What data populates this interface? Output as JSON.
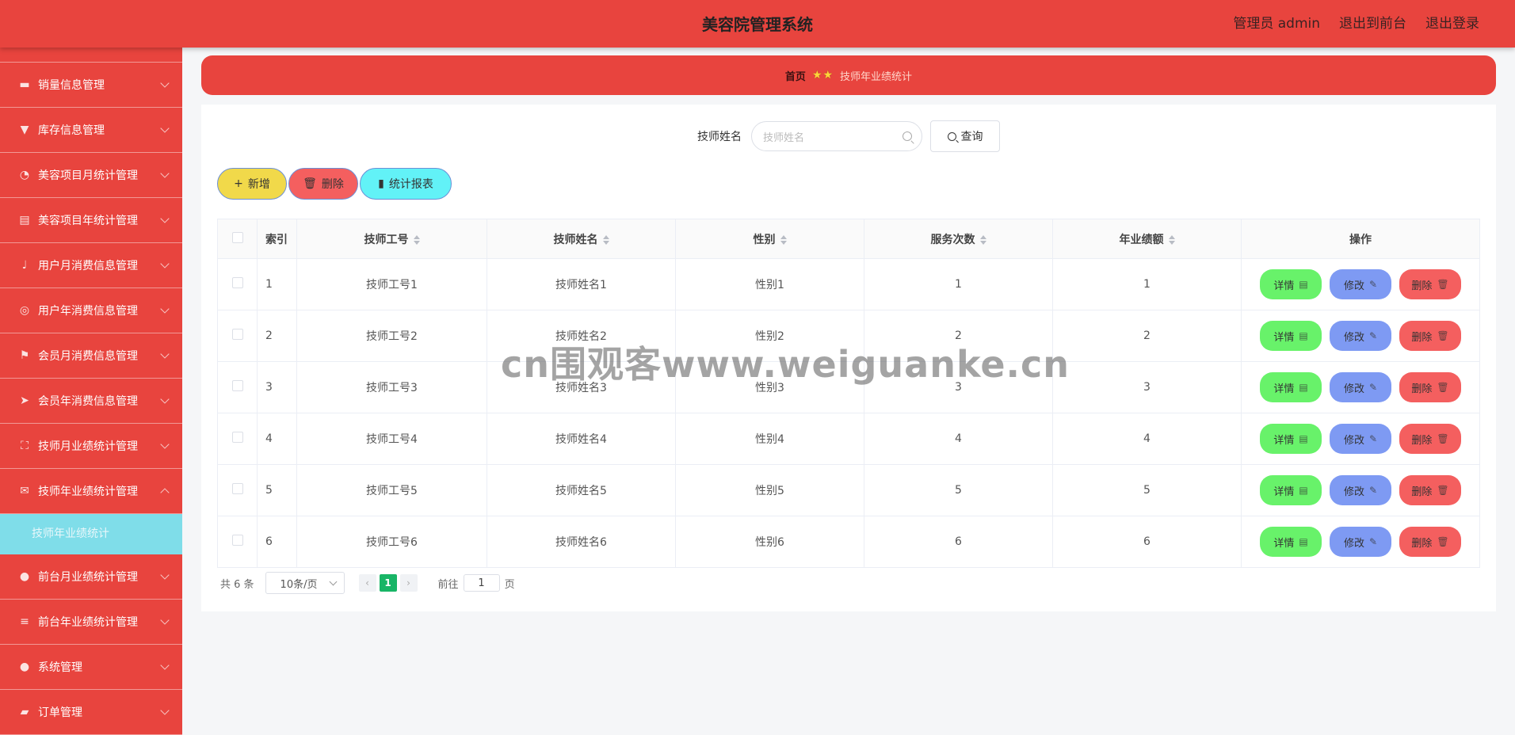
{
  "header": {
    "title": "美容院管理系统",
    "user": "管理员 admin",
    "front_link": "退出到前台",
    "logout": "退出登录"
  },
  "sidebar": {
    "items": [
      {
        "label": "销量信息管理",
        "icon": "briefcase-icon"
      },
      {
        "label": "库存信息管理",
        "icon": "brush-icon"
      },
      {
        "label": "美容项目月统计管理",
        "icon": "dashboard-icon"
      },
      {
        "label": "美容项目年统计管理",
        "icon": "clipboard-icon"
      },
      {
        "label": "用户月消费信息管理",
        "icon": "microphone-icon"
      },
      {
        "label": "用户年消费信息管理",
        "icon": "compass-icon"
      },
      {
        "label": "会员月消费信息管理",
        "icon": "flag-icon"
      },
      {
        "label": "会员年消费信息管理",
        "icon": "send-icon"
      },
      {
        "label": "技师月业绩统计管理",
        "icon": "fullscreen-icon"
      },
      {
        "label": "技师年业绩统计管理",
        "icon": "mail-icon"
      },
      {
        "label": "前台月业绩统计管理",
        "icon": "location-icon"
      },
      {
        "label": "前台年业绩统计管理",
        "icon": "menu-icon"
      },
      {
        "label": "系统管理",
        "icon": "user-icon"
      },
      {
        "label": "订单管理",
        "icon": "ticket-icon"
      }
    ],
    "submenu_label": "技师年业绩统计"
  },
  "breadcrumb": {
    "home": "首页",
    "current": "技师年业绩统计"
  },
  "search": {
    "label": "技师姓名",
    "placeholder": "技师姓名",
    "button": "查询"
  },
  "actions": {
    "add": "新增",
    "delete": "删除",
    "report": "统计报表"
  },
  "table": {
    "headers": {
      "index": "索引",
      "id": "技师工号",
      "name": "技师姓名",
      "gender": "性别",
      "count": "服务次数",
      "amount": "年业绩额",
      "ops": "操作"
    },
    "rows": [
      {
        "index": "1",
        "id": "技师工号1",
        "name": "技师姓名1",
        "gender": "性别1",
        "count": "1",
        "amount": "1"
      },
      {
        "index": "2",
        "id": "技师工号2",
        "name": "技师姓名2",
        "gender": "性别2",
        "count": "2",
        "amount": "2"
      },
      {
        "index": "3",
        "id": "技师工号3",
        "name": "技师姓名3",
        "gender": "性别3",
        "count": "3",
        "amount": "3"
      },
      {
        "index": "4",
        "id": "技师工号4",
        "name": "技师姓名4",
        "gender": "性别4",
        "count": "4",
        "amount": "4"
      },
      {
        "index": "5",
        "id": "技师工号5",
        "name": "技师姓名5",
        "gender": "性别5",
        "count": "5",
        "amount": "5"
      },
      {
        "index": "6",
        "id": "技师工号6",
        "name": "技师姓名6",
        "gender": "性别6",
        "count": "6",
        "amount": "6"
      }
    ],
    "op_labels": {
      "detail": "详情",
      "edit": "修改",
      "remove": "删除"
    }
  },
  "pagination": {
    "total": "共 6 条",
    "page_size": "10条/页",
    "current_page": "1",
    "goto_label": "前往",
    "goto_value": "1",
    "page_unit": "页"
  },
  "watermark": "cn围观客www.weiguanke.cn"
}
